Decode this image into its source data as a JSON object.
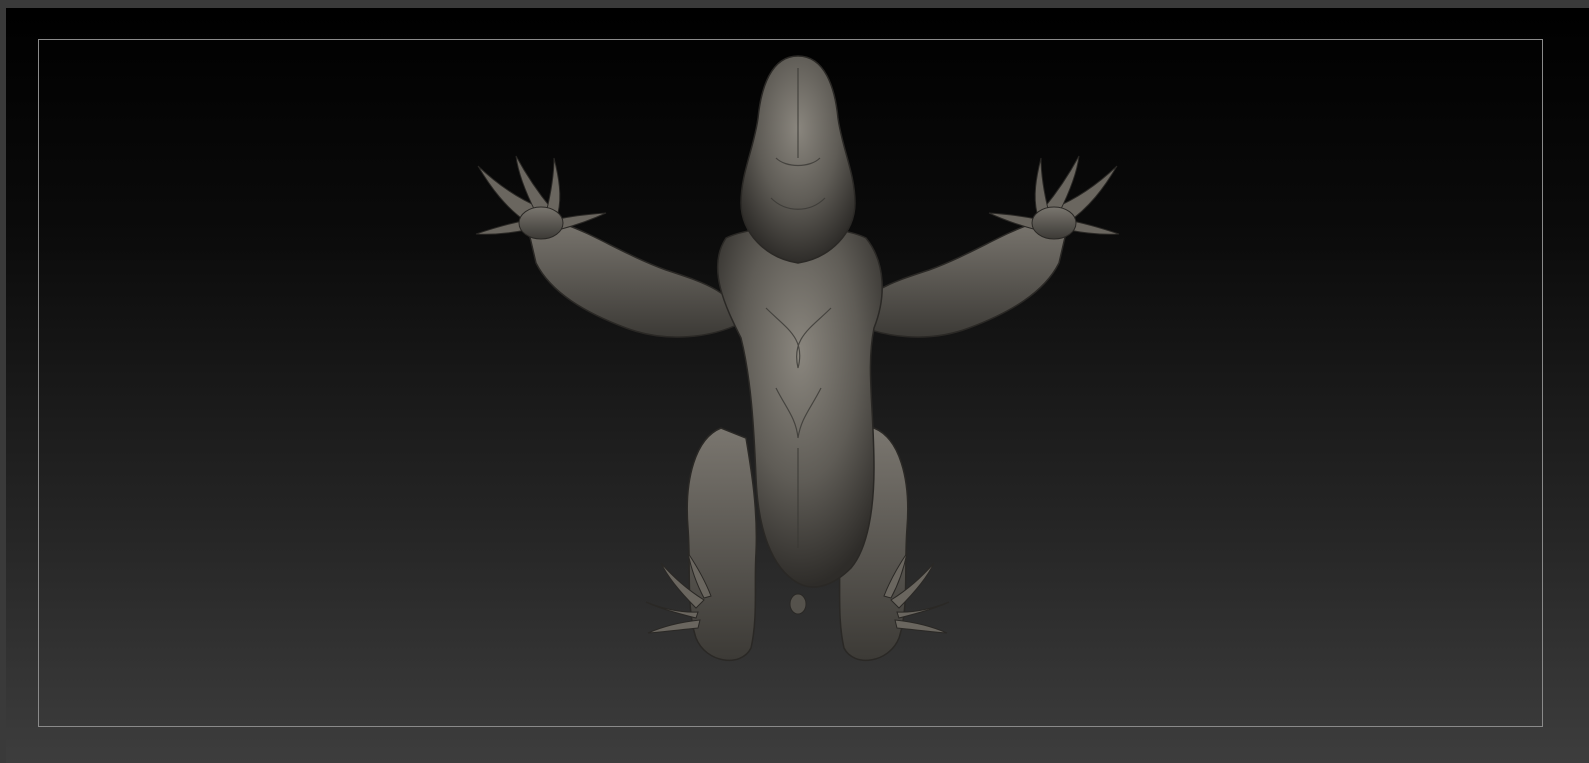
{
  "viewport": {
    "model_name": "creature-sculpt",
    "colors": {
      "background_top": "#000000",
      "background_bottom": "#3d3d3d",
      "frame_border": "#8a8a8a",
      "model_base": "#5f5c56",
      "model_highlight": "#8a867e",
      "model_shadow": "#2e2c29"
    }
  }
}
